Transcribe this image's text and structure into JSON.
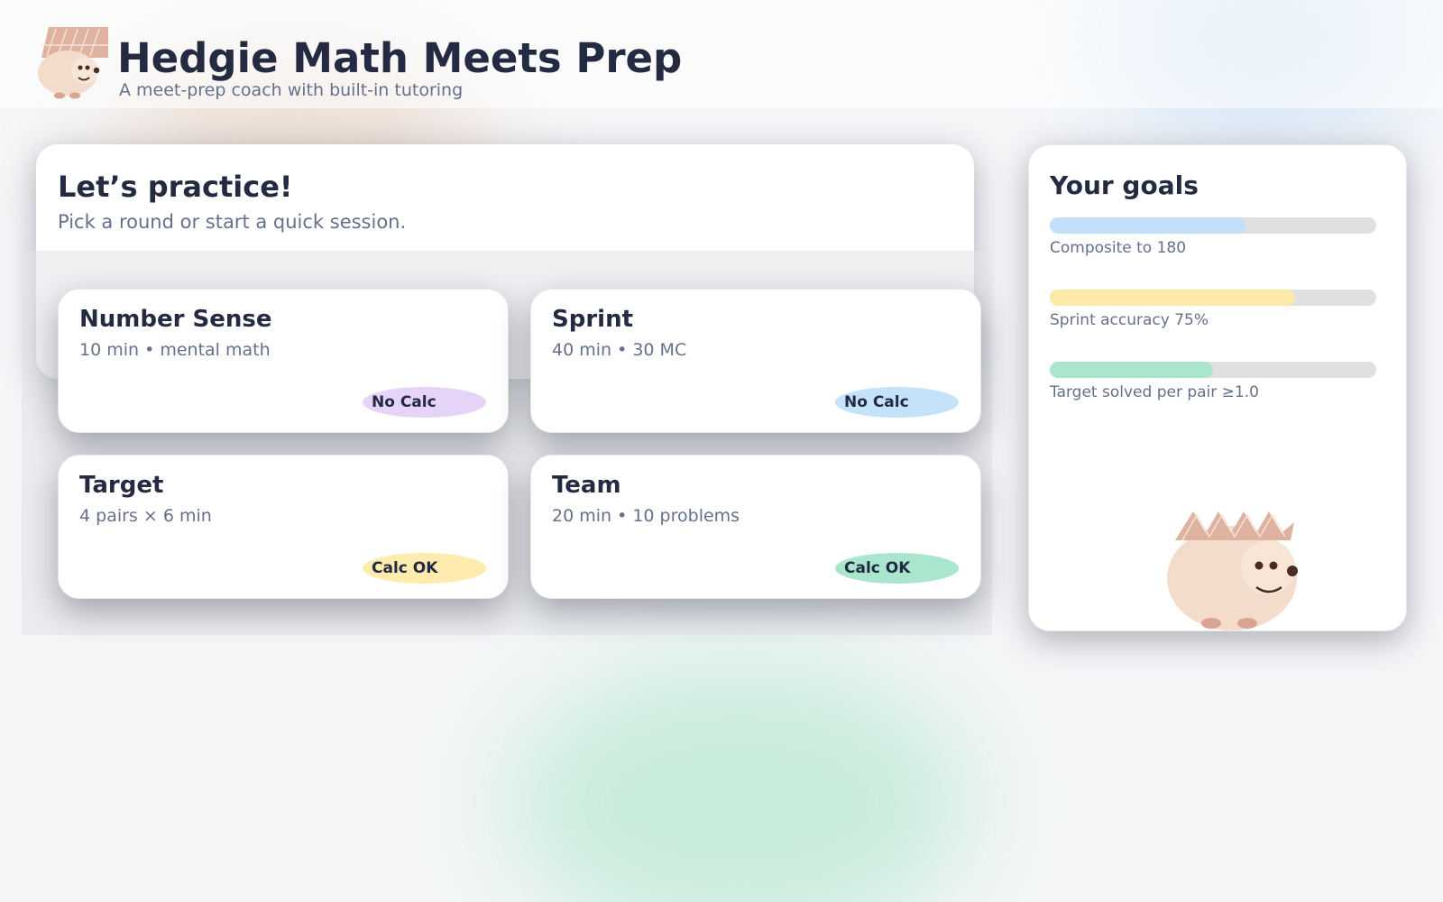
{
  "header": {
    "title": "Hedgie Math Meets Prep",
    "subtitle": "A meet-prep coach with built-in tutoring",
    "logo_icon": "hedgehog-logo-icon"
  },
  "practice": {
    "title": "Let’s practice!",
    "subtitle": "Pick a round or start a quick session."
  },
  "rounds": [
    {
      "name": "Number Sense",
      "meta": "10 min • mental math",
      "badge": "No Calc",
      "badge_color": "#e6d3f8"
    },
    {
      "name": "Sprint",
      "meta": "40 min • 30 MC",
      "badge": "No Calc",
      "badge_color": "#c5e2fb"
    },
    {
      "name": "Target",
      "meta": "4 pairs × 6 min",
      "badge": "Calc OK",
      "badge_color": "#fdecae"
    },
    {
      "name": "Team",
      "meta": "20 min • 10 problems",
      "badge": "Calc OK",
      "badge_color": "#a9e6cd"
    }
  ],
  "goals": {
    "title": "Your goals",
    "items": [
      {
        "label": "Composite to 180",
        "progress": 0.6,
        "color": "#c2dffb"
      },
      {
        "label": "Sprint accuracy 75%",
        "progress": 0.75,
        "color": "#fde9a8"
      },
      {
        "label": "Target solved per pair ≥1.0",
        "progress": 0.5,
        "color": "#a9e6cd"
      }
    ],
    "mascot_icon": "hedgehog-mascot-icon"
  },
  "colors": {
    "text_dark": "#232a42",
    "text_muted": "#66708c",
    "hedgehog_body": "#f3dccb",
    "hedgehog_spikes": "#deb29f",
    "hedgehog_face": "#f7e6d7",
    "hedgehog_features": "#4a2a22"
  }
}
